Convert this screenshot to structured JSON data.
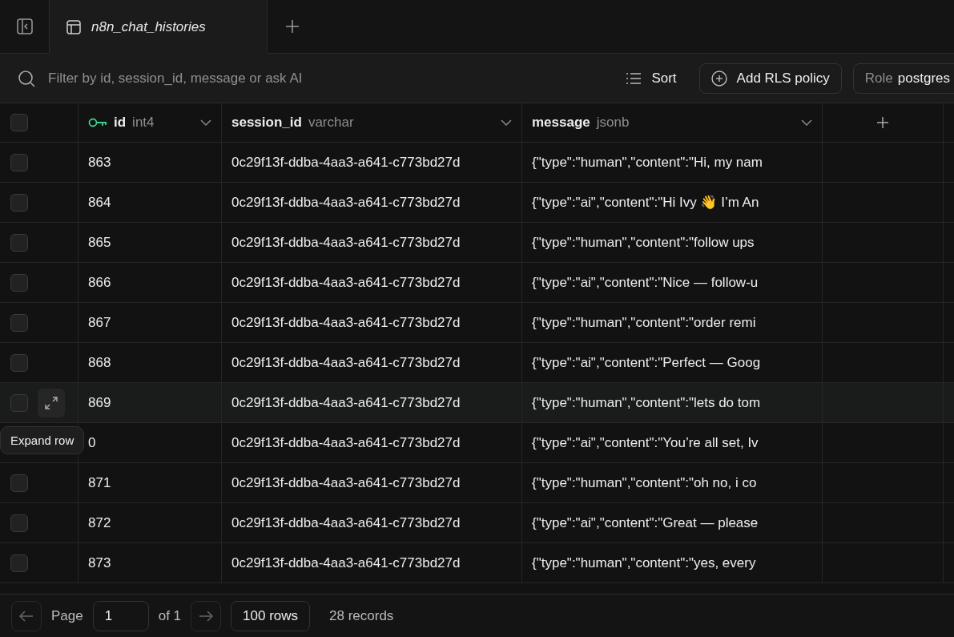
{
  "tabs": [
    {
      "label": "n8n_chat_histories",
      "selected": true
    }
  ],
  "toolbar": {
    "search_placeholder": "Filter by id, session_id, message or ask AI",
    "sort": "Sort",
    "add_policy": "Add RLS policy",
    "role_label": "Role",
    "role_value": "postgres"
  },
  "table": {
    "select_all_checked": false,
    "columns": [
      {
        "name": "id",
        "type": "int4",
        "primary_key": true
      },
      {
        "name": "session_id",
        "type": "varchar",
        "primary_key": false
      },
      {
        "name": "message",
        "type": "jsonb",
        "primary_key": false
      }
    ],
    "rows": [
      {
        "checked": false,
        "hovered": false,
        "cells": [
          "863",
          "0c29f13f-ddba-4aa3-a641-c773bd27d",
          "{\"type\":\"human\",\"content\":\"Hi, my nam"
        ]
      },
      {
        "checked": false,
        "hovered": false,
        "cells": [
          "864",
          "0c29f13f-ddba-4aa3-a641-c773bd27d",
          "{\"type\":\"ai\",\"content\":\"Hi Ivy 👋 I’m An"
        ]
      },
      {
        "checked": false,
        "hovered": false,
        "cells": [
          "865",
          "0c29f13f-ddba-4aa3-a641-c773bd27d",
          "{\"type\":\"human\",\"content\":\"follow ups"
        ]
      },
      {
        "checked": false,
        "hovered": false,
        "cells": [
          "866",
          "0c29f13f-ddba-4aa3-a641-c773bd27d",
          "{\"type\":\"ai\",\"content\":\"Nice — follow-u"
        ]
      },
      {
        "checked": false,
        "hovered": false,
        "cells": [
          "867",
          "0c29f13f-ddba-4aa3-a641-c773bd27d",
          "{\"type\":\"human\",\"content\":\"order remi"
        ]
      },
      {
        "checked": false,
        "hovered": false,
        "cells": [
          "868",
          "0c29f13f-ddba-4aa3-a641-c773bd27d",
          "{\"type\":\"ai\",\"content\":\"Perfect — Goog"
        ]
      },
      {
        "checked": false,
        "hovered": true,
        "cells": [
          "869",
          "0c29f13f-ddba-4aa3-a641-c773bd27d",
          "{\"type\":\"human\",\"content\":\"lets do tom"
        ]
      },
      {
        "hovered": false,
        "cells": [
          "0",
          "0c29f13f-ddba-4aa3-a641-c773bd27d",
          "{\"type\":\"ai\",\"content\":\"You’re all set, Iv"
        ]
      },
      {
        "checked": false,
        "hovered": false,
        "cells": [
          "871",
          "0c29f13f-ddba-4aa3-a641-c773bd27d",
          "{\"type\":\"human\",\"content\":\"oh no, i co"
        ]
      },
      {
        "checked": false,
        "hovered": false,
        "cells": [
          "872",
          "0c29f13f-ddba-4aa3-a641-c773bd27d",
          "{\"type\":\"ai\",\"content\":\"Great — please"
        ]
      },
      {
        "checked": false,
        "hovered": false,
        "cells": [
          "873",
          "0c29f13f-ddba-4aa3-a641-c773bd27d",
          "{\"type\":\"human\",\"content\":\"yes, every"
        ]
      }
    ]
  },
  "tooltip": "Expand row",
  "footer": {
    "page_label": "Page",
    "page_value": "1",
    "of": "of 1",
    "rows": "100 rows",
    "records": "28 records"
  }
}
